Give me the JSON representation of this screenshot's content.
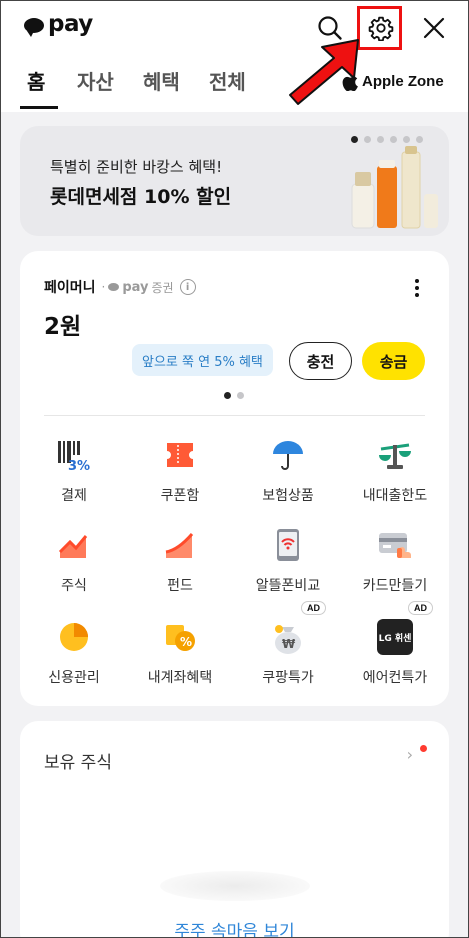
{
  "header": {
    "logo_text": "pay",
    "tabs": [
      "홈",
      "자산",
      "혜택",
      "전체"
    ],
    "active_tab": "홈",
    "apple_zone_label": "Apple Zone"
  },
  "banner": {
    "subtitle": "특별히 준비한 바캉스 혜택!",
    "title": "롯데면세점 10% 할인",
    "page_count": 6,
    "current_page": 1
  },
  "pay_money": {
    "label": "페이머니",
    "brand": "pay",
    "brand_suffix": "증권",
    "balance": "2원",
    "benefit_text": "앞으로 쭉 연 5% 혜택",
    "charge_label": "충전",
    "send_label": "송금",
    "page_count": 2,
    "current_page": 1
  },
  "menu": [
    {
      "label": "결제",
      "icon": "payment-3percent-icon"
    },
    {
      "label": "쿠폰함",
      "icon": "coupon-icon"
    },
    {
      "label": "보험상품",
      "icon": "umbrella-icon"
    },
    {
      "label": "내대출한도",
      "icon": "scale-icon"
    },
    {
      "label": "주식",
      "icon": "stock-chart-icon"
    },
    {
      "label": "펀드",
      "icon": "fund-chart-icon"
    },
    {
      "label": "알뜰폰비교",
      "icon": "phone-wifi-icon"
    },
    {
      "label": "카드만들기",
      "icon": "card-icon"
    },
    {
      "label": "신용관리",
      "icon": "credit-pie-icon"
    },
    {
      "label": "내계좌혜택",
      "icon": "account-benefit-icon"
    },
    {
      "label": "쿠팡특가",
      "icon": "money-bag-icon",
      "badge": "AD"
    },
    {
      "label": "에어컨특가",
      "icon": "lg-whisen-icon",
      "badge": "AD",
      "icon_text": "LG 휘센"
    }
  ],
  "stocks": {
    "title": "보유 주식",
    "link_text": "주주 속마음 보기"
  },
  "colors": {
    "accent_yellow": "#ffe200",
    "highlight_red": "#ee1111",
    "link_blue": "#2f86d8",
    "badge_blue_bg": "#e4f1fb"
  }
}
